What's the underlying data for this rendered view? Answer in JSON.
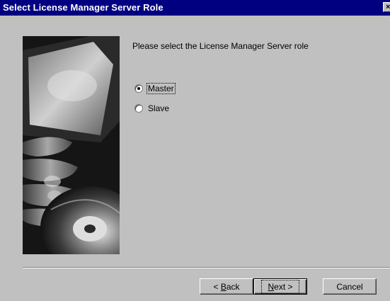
{
  "window": {
    "title": "Select License Manager Server Role",
    "close_glyph": "×"
  },
  "content": {
    "prompt": "Please select the License Manager Server role",
    "options": [
      {
        "label": "Master",
        "selected": true
      },
      {
        "label": "Slave",
        "selected": false
      }
    ]
  },
  "buttons": {
    "back_prefix": "< ",
    "back_accel": "B",
    "back_rest": "ack",
    "next_accel": "N",
    "next_rest": "ext >",
    "cancel": "Cancel"
  },
  "side_image": {
    "icon": "cd-disc-hand-image"
  },
  "colors": {
    "titlebar": "#000080",
    "face": "#c0c0c0"
  }
}
